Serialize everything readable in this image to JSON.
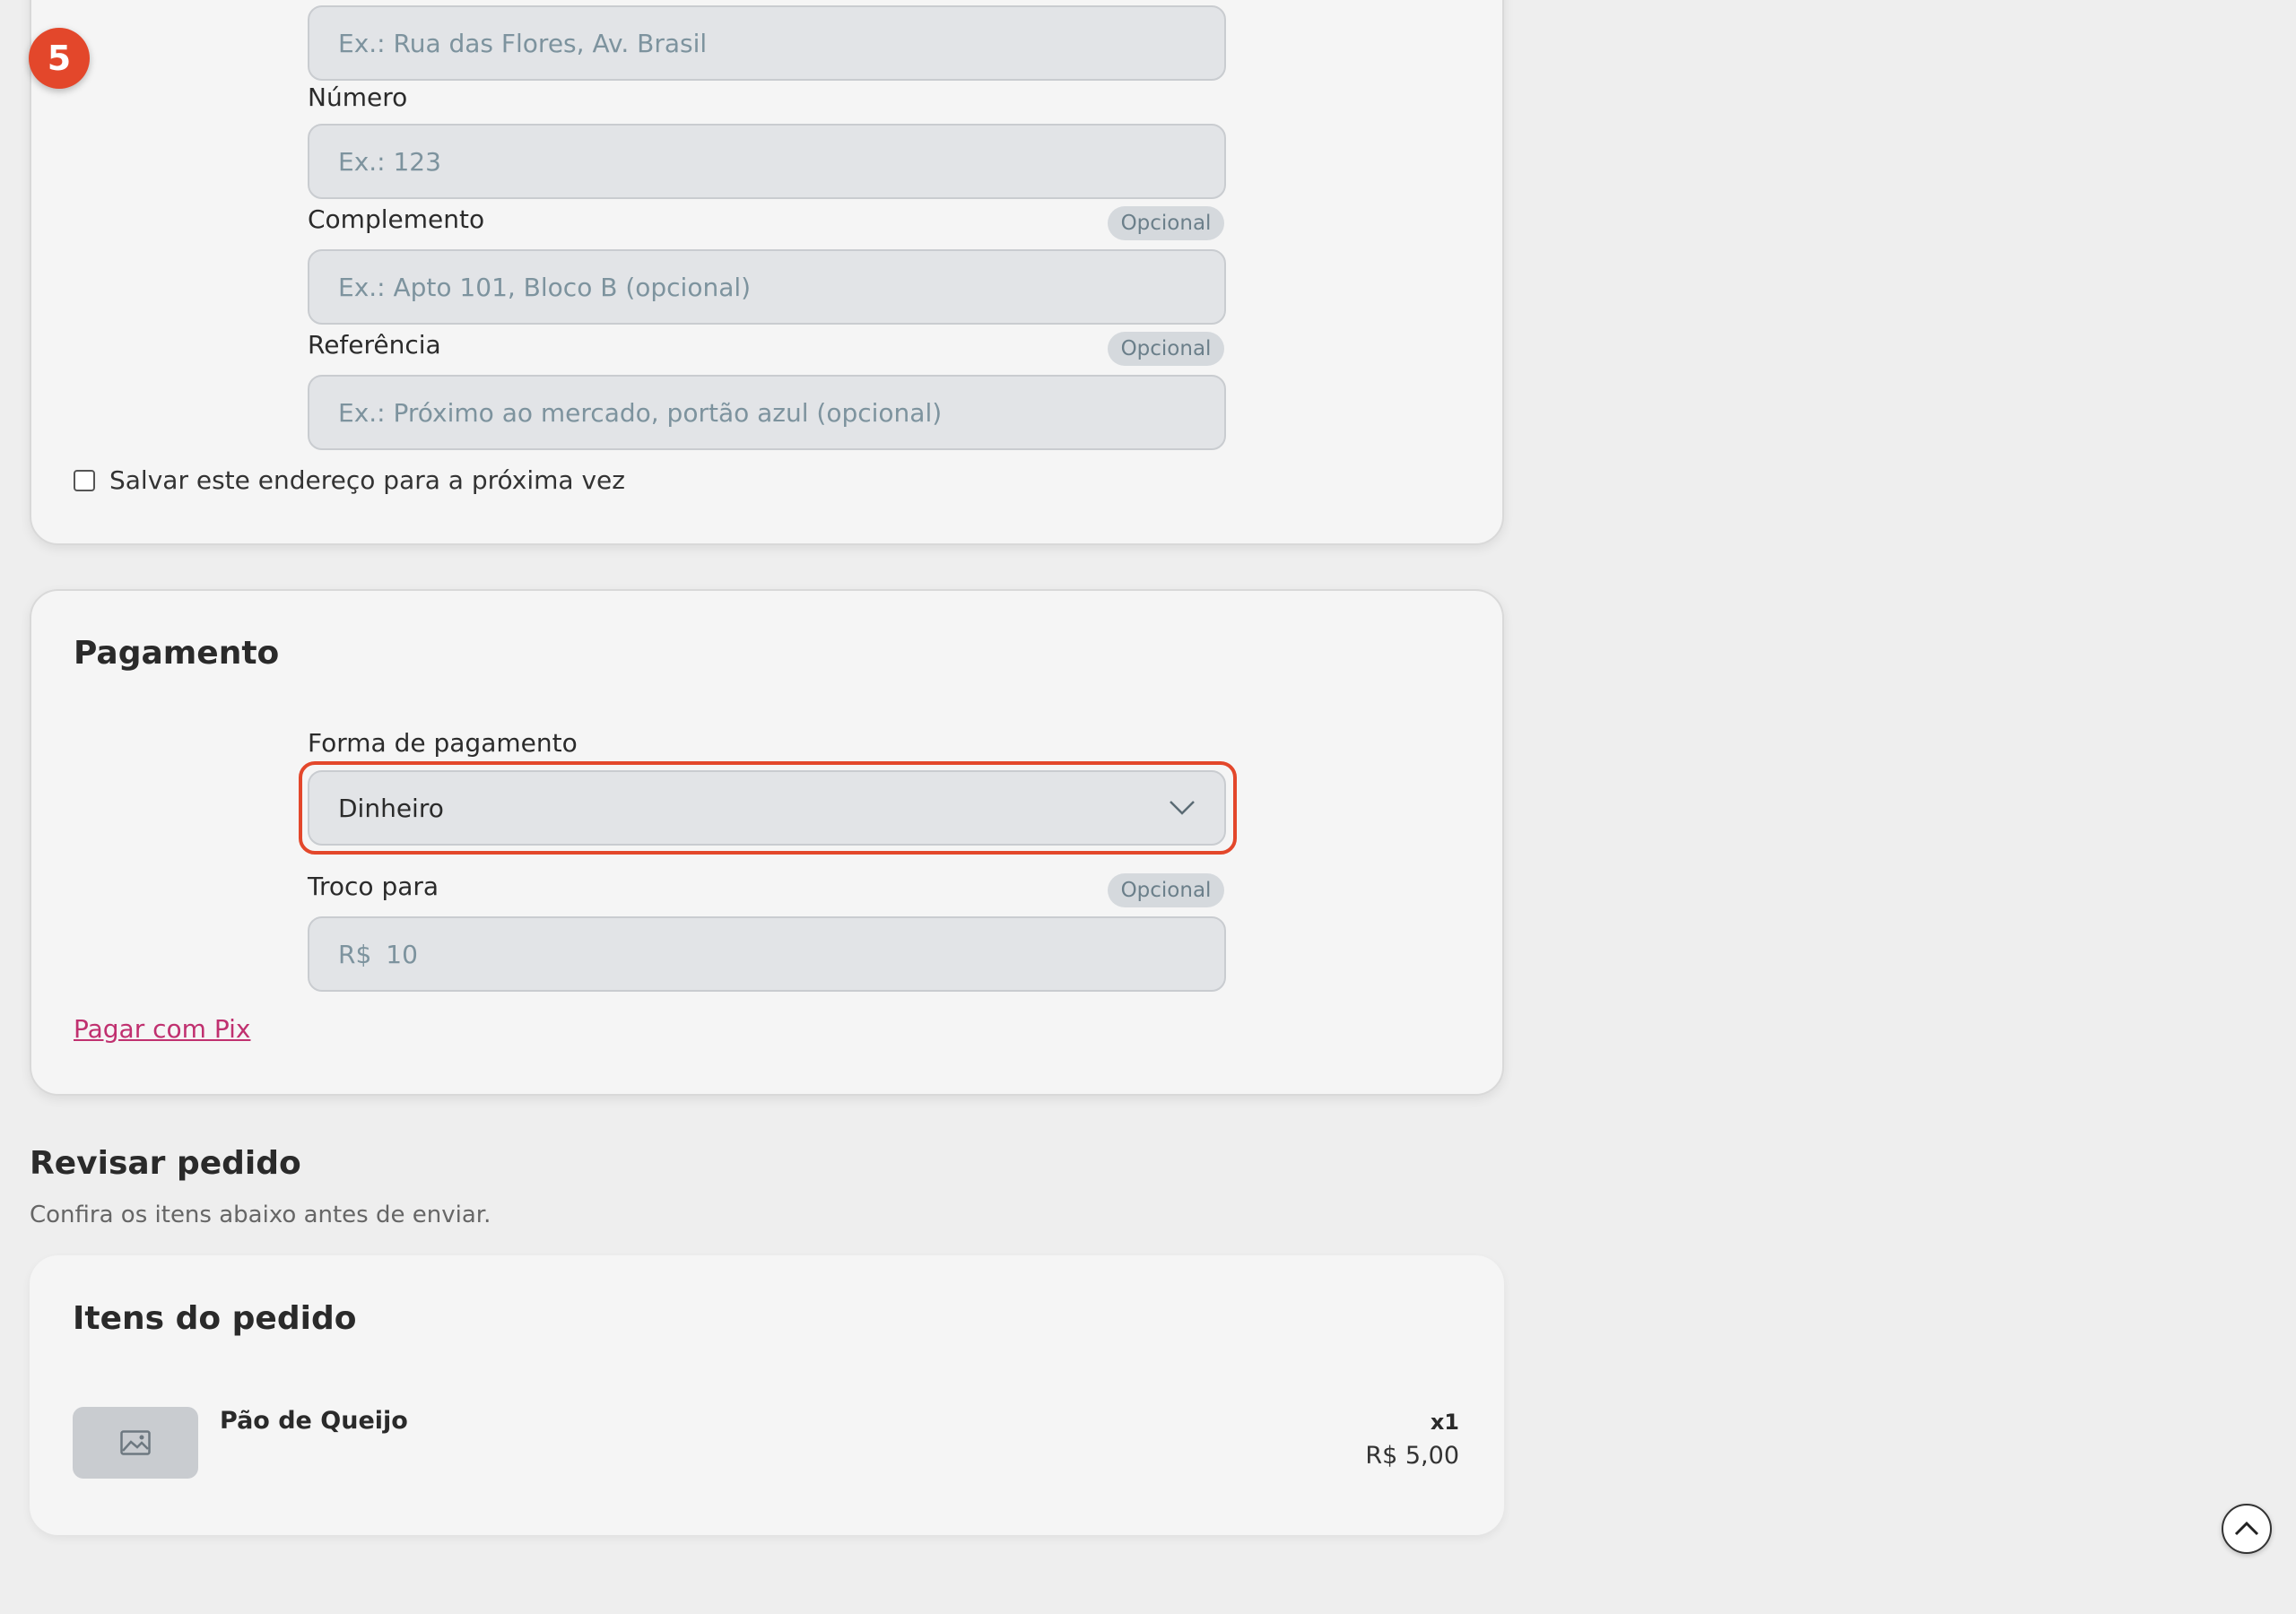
{
  "step_badge": "5",
  "address": {
    "street_placeholder": "Ex.: Rua das Flores, Av. Brasil",
    "number_label": "Número",
    "number_placeholder": "Ex.: 123",
    "complement_label": "Complemento",
    "complement_optional": "Opcional",
    "complement_placeholder": "Ex.: Apto 101, Bloco B (opcional)",
    "reference_label": "Referência",
    "reference_optional": "Opcional",
    "reference_placeholder": "Ex.: Próximo ao mercado, portão azul (opcional)",
    "save_address_label": "Salvar este endereço para a próxima vez"
  },
  "payment": {
    "title": "Pagamento",
    "method_label": "Forma de pagamento",
    "method_value": "Dinheiro",
    "change_label": "Troco para",
    "change_optional": "Opcional",
    "change_prefix": "R$",
    "change_value": "10",
    "pix_link": "Pagar com Pix"
  },
  "review": {
    "title": "Revisar pedido",
    "subtitle": "Confira os itens abaixo antes de enviar.",
    "items_title": "Itens do pedido",
    "items": [
      {
        "name": "Pão de Queijo",
        "qty": "x1",
        "price": "R$ 5,00"
      }
    ]
  },
  "colors": {
    "accent": "#e3472b",
    "link": "#c0306f"
  }
}
